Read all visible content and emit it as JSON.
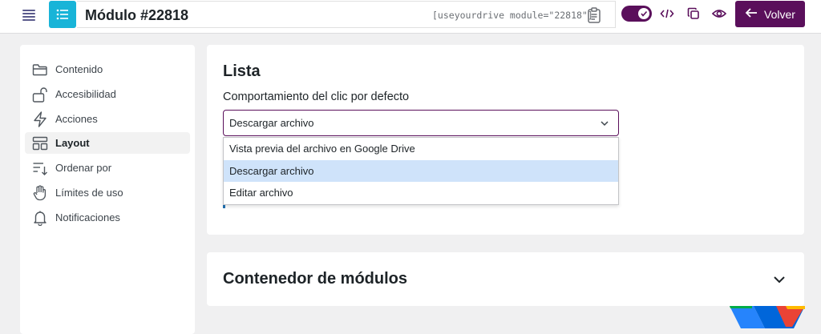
{
  "header": {
    "title": "Módulo #22818",
    "shortcode": "[useyourdrive module=\"22818\"]",
    "back_label": "Volver",
    "icons": [
      "hamburger-icon",
      "list-icon",
      "clipboard-icon",
      "code-icon",
      "duplicate-icon",
      "eye-icon",
      "arrow-left-icon"
    ],
    "toggle_on": true
  },
  "sidebar": {
    "items": [
      {
        "label": "Contenido",
        "icon": "folder-icon"
      },
      {
        "label": "Accesibilidad",
        "icon": "lock-icon"
      },
      {
        "label": "Acciones",
        "icon": "bolt-icon"
      },
      {
        "label": "Layout",
        "icon": "layout-icon",
        "active": true
      },
      {
        "label": "Ordenar por",
        "icon": "sort-icon"
      },
      {
        "label": "Límites de uso",
        "icon": "hand-icon"
      },
      {
        "label": "Notificaciones",
        "icon": "bell-icon"
      }
    ]
  },
  "main": {
    "section_title": "Lista",
    "field_label": "Comportamiento del clic por defecto",
    "select_value": "Descargar archivo",
    "options": [
      "Vista previa del archivo en Google Drive",
      "Descargar archivo",
      "Editar archivo"
    ],
    "selected_index": 1,
    "section2_title": "Contenedor de módulos"
  },
  "colors": {
    "brand": "#5a0f5b",
    "accent": "#18b4d8",
    "selected_option": "#cfe3fa"
  }
}
